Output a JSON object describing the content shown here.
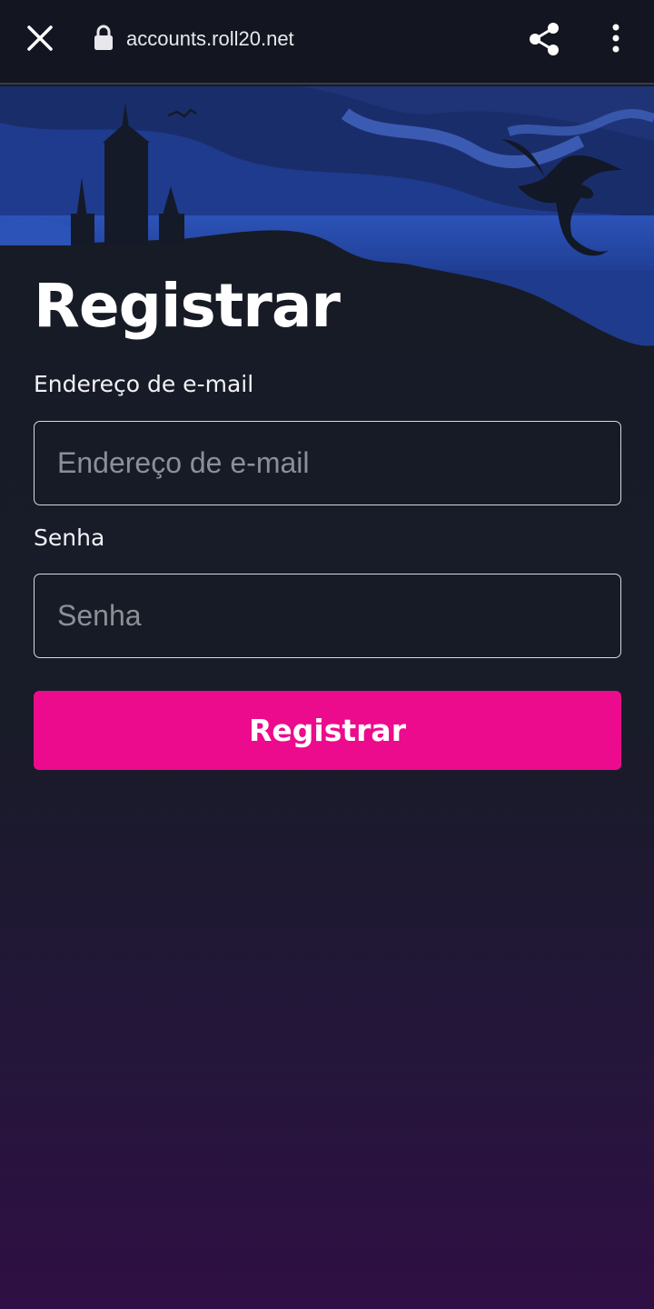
{
  "browser": {
    "url": "accounts.roll20.net",
    "icons": {
      "close": "close-icon",
      "lock": "lock-icon",
      "share": "share-icon",
      "menu": "more-vert-icon"
    }
  },
  "page": {
    "title": "Registrar"
  },
  "form": {
    "email_label": "Endereço de e-mail",
    "email_placeholder": "Endereço de e-mail",
    "email_value": "",
    "password_label": "Senha",
    "password_placeholder": "Senha",
    "password_value": "",
    "submit_label": "Registrar"
  },
  "colors": {
    "accent": "#ec0b8d",
    "background_top": "#161b26",
    "background_bottom": "#2f0f44",
    "hero_blue": "#2a4fb0"
  }
}
